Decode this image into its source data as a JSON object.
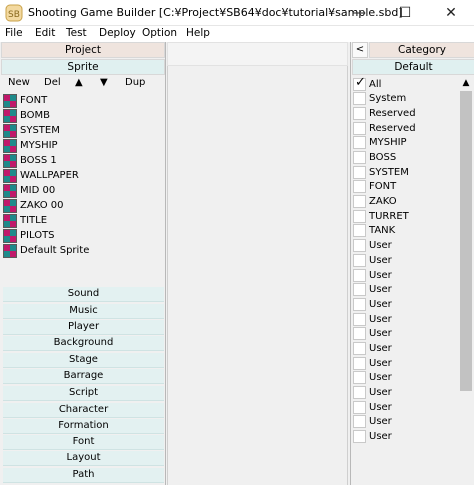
{
  "window": {
    "title": "Shooting Game Builder [C:¥Project¥SB64¥doc¥tutorial¥sample.sbd]",
    "minimize_glyph": "—",
    "maximize_glyph": "☐",
    "close_glyph": "✕"
  },
  "menu": [
    "File",
    "Edit",
    "Test",
    "Deploy",
    "Option",
    "Help"
  ],
  "left": {
    "project_label": "Project",
    "sprite_label": "Sprite",
    "toolbar": {
      "new": "New",
      "del": "Del",
      "up": "▲",
      "down": "▼",
      "dup": "Dup"
    },
    "sprites": [
      "FONT",
      "BOMB",
      "SYSTEM",
      "MYSHIP",
      "BOSS 1",
      "WALLPAPER",
      "MID 00",
      "ZAKO 00",
      "TITLE",
      "PILOTS",
      "Default Sprite"
    ],
    "categories": [
      "Sound",
      "Music",
      "Player",
      "Background",
      "Stage",
      "Barrage",
      "Script",
      "Character",
      "Formation",
      "Font",
      "Layout",
      "Path"
    ]
  },
  "right": {
    "collapse_label": "<",
    "category_label": "Category",
    "default_label": "Default",
    "items": [
      {
        "label": "All",
        "checked": true
      },
      {
        "label": "System",
        "checked": false
      },
      {
        "label": "Reserved",
        "checked": false
      },
      {
        "label": "Reserved",
        "checked": false
      },
      {
        "label": "MYSHIP",
        "checked": false
      },
      {
        "label": "BOSS",
        "checked": false
      },
      {
        "label": "SYSTEM",
        "checked": false
      },
      {
        "label": "FONT",
        "checked": false
      },
      {
        "label": "ZAKO",
        "checked": false
      },
      {
        "label": "TURRET",
        "checked": false
      },
      {
        "label": "TANK",
        "checked": false
      },
      {
        "label": "User",
        "checked": false
      },
      {
        "label": "User",
        "checked": false
      },
      {
        "label": "User",
        "checked": false
      },
      {
        "label": "User",
        "checked": false
      },
      {
        "label": "User",
        "checked": false
      },
      {
        "label": "User",
        "checked": false
      },
      {
        "label": "User",
        "checked": false
      },
      {
        "label": "User",
        "checked": false
      },
      {
        "label": "User",
        "checked": false
      },
      {
        "label": "User",
        "checked": false
      },
      {
        "label": "User",
        "checked": false
      },
      {
        "label": "User",
        "checked": false
      },
      {
        "label": "User",
        "checked": false
      },
      {
        "label": "User",
        "checked": false
      }
    ],
    "scroll_up": "▲"
  },
  "colors": {
    "project_header": "#efe4de",
    "sprite_header": "#e0f0f0",
    "category_button": "#e3f1f1",
    "sprite_icon_magenta": "#c0186a",
    "sprite_icon_teal": "#1e8a8a"
  }
}
